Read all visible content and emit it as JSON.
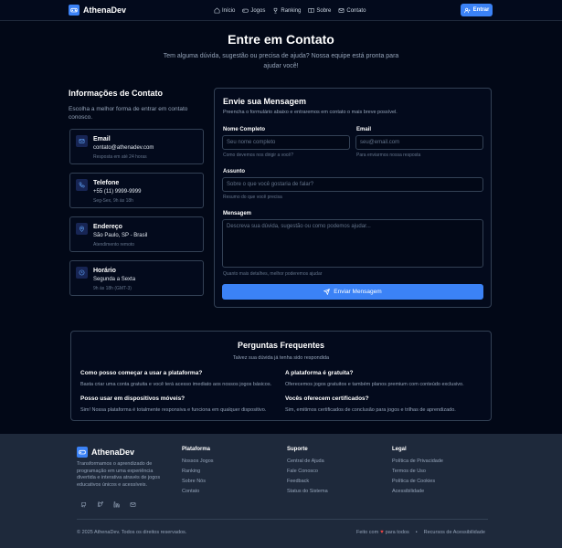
{
  "header": {
    "logo": "AthenaDev",
    "nav": [
      "Início",
      "Jogos",
      "Ranking",
      "Sobre",
      "Contato"
    ],
    "login": "Entrar"
  },
  "hero": {
    "title": "Entre em Contato",
    "subtitle": "Tem alguma dúvida, sugestão ou precisa de ajuda? Nossa equipe está pronta para ajudar você!"
  },
  "info": {
    "title": "Informações de Contato",
    "desc": "Escolha a melhor forma de entrar em contato conosco.",
    "cards": [
      {
        "label": "Email",
        "value": "contato@athenadev.com",
        "note": "Resposta em até 24 horas"
      },
      {
        "label": "Telefone",
        "value": "+55 (11) 9999-9999",
        "note": "Seg-Sex, 9h às 18h"
      },
      {
        "label": "Endereço",
        "value": "São Paulo, SP - Brasil",
        "note": "Atendimento remoto"
      },
      {
        "label": "Horário",
        "value": "Segunda a Sexta",
        "note": "9h às 18h (GMT-3)"
      }
    ]
  },
  "form": {
    "title": "Envie sua Mensagem",
    "desc": "Preencha o formulário abaixo e entraremos em contato o mais breve possível.",
    "name_label": "Nome Completo",
    "name_placeholder": "Seu nome completo",
    "name_hint": "Como devemos nos dirigir a você?",
    "email_label": "Email",
    "email_placeholder": "seu@email.com",
    "email_hint": "Para enviarmos nossa resposta",
    "subject_label": "Assunto",
    "subject_placeholder": "Sobre o que você gostaria de falar?",
    "subject_hint": "Resumo do que você precisa",
    "message_label": "Mensagem",
    "message_placeholder": "Descreva sua dúvida, sugestão ou como podemos ajudar...",
    "message_hint": "Quanto mais detalhes, melhor poderemos ajudar",
    "submit": "Enviar Mensagem"
  },
  "faq": {
    "title": "Perguntas Frequentes",
    "subtitle": "Talvez sua dúvida já tenha sido respondida",
    "items": [
      {
        "q": "Como posso começar a usar a plataforma?",
        "a": "Basta criar uma conta gratuita e você terá acesso imediato aos nossos jogos básicos."
      },
      {
        "q": "A plataforma é gratuita?",
        "a": "Oferecemos jogos gratuitos e também planos premium com conteúdo exclusivo."
      },
      {
        "q": "Posso usar em dispositivos móveis?",
        "a": "Sim! Nossa plataforma é totalmente responsiva e funciona em qualquer dispositivo."
      },
      {
        "q": "Vocês oferecem certificados?",
        "a": "Sim, emitimos certificados de conclusão para jogos e trilhas de aprendizado."
      }
    ]
  },
  "footer": {
    "logo": "AthenaDev",
    "desc": "Transformamos o aprendizado de programação em uma experiência divertida e interativa através de jogos educativos únicos e acessíveis.",
    "cols": [
      {
        "title": "Plataforma",
        "links": [
          "Nossos Jogos",
          "Ranking",
          "Sobre Nós",
          "Contato"
        ]
      },
      {
        "title": "Suporte",
        "links": [
          "Central de Ajuda",
          "Fale Conosco",
          "Feedback",
          "Status do Sistema"
        ]
      },
      {
        "title": "Legal",
        "links": [
          "Política de Privacidade",
          "Termos de Uso",
          "Política de Cookies",
          "Acessibilidade"
        ]
      }
    ],
    "copyright": "© 2025 AthenaDev. Todos os direitos reservados.",
    "made_prefix": "Feito com",
    "made_suffix": "para todos",
    "accessibility": "Recursos de Acessibilidade"
  }
}
